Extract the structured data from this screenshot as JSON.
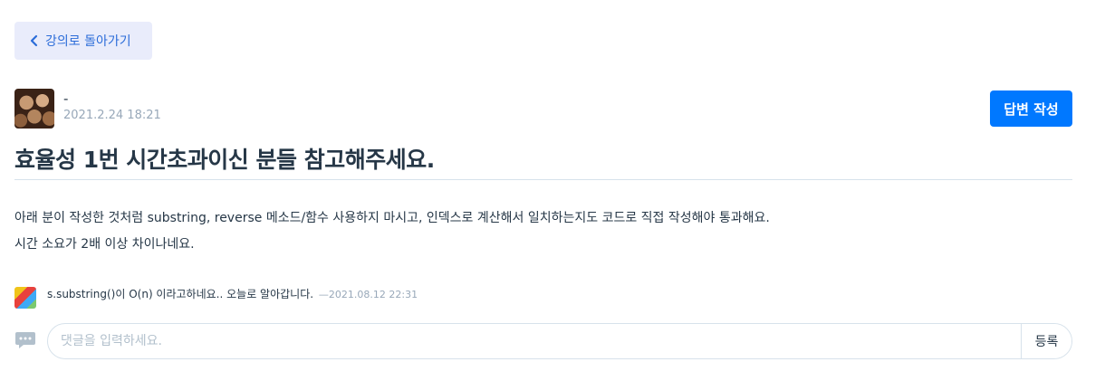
{
  "nav": {
    "back_label": "강의로 돌아가기"
  },
  "post": {
    "author": "-",
    "date": "2021.2.24 18:21",
    "answer_label": "답변 작성",
    "title": "효율성 1번 시간초과이신 분들 참고해주세요.",
    "body": [
      "아래 분이 작성한 것처럼 substring, reverse 메소드/함수 사용하지 마시고, 인덱스로 계산해서 일치하는지도 코드로 직접 작성해야 통과해요.",
      "시간 소요가 2배 이상 차이나네요."
    ]
  },
  "comments": [
    {
      "text": "s.substring()이 O(n) 이라고하네요.. 오늘로 알아갑니다.",
      "date": "—2021.08.12 22:31"
    }
  ],
  "comment_form": {
    "placeholder": "댓글을 입력하세요.",
    "submit_label": "등록"
  },
  "colors": {
    "accent": "#0078ff",
    "back_bg": "#e9ecfb",
    "back_text": "#2b6cd9",
    "muted": "#98a8b9"
  }
}
